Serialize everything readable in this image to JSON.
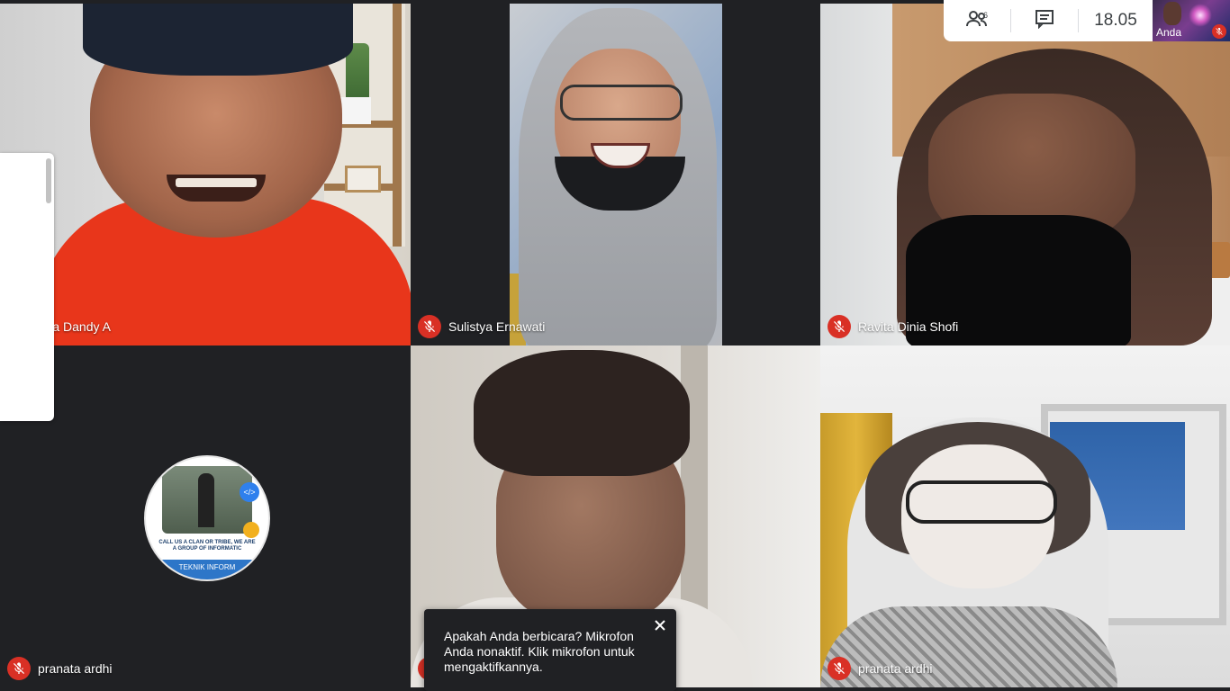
{
  "participants": [
    {
      "name": "Eza Dandy A",
      "mic": "off"
    },
    {
      "name": "Sulistya Ernawati",
      "mic": "off"
    },
    {
      "name": "Ravita Dinia Shofi",
      "mic": "off"
    },
    {
      "name": "pranata ardhi",
      "mic": "off"
    },
    {
      "name": "",
      "mic": "off"
    },
    {
      "name": "pranata ardhi",
      "mic": "off"
    }
  ],
  "avatar": {
    "slogan": "CALL US A CLAN OR TRIBE, WE ARE A GROUP OF INFORMATIC",
    "band": "TEKNIK INFORM"
  },
  "toolbar": {
    "people_count": "6",
    "time": "18.05"
  },
  "self_view": {
    "label": "Anda"
  },
  "toast": {
    "message": "Apakah Anda berbicara? Mikrofon Anda nonaktif. Klik mikrofon untuk mengaktifkannya."
  },
  "colors": {
    "background": "#202124",
    "mic_off": "#d93025",
    "toolbar": "#ffffff"
  },
  "icons": [
    "mic-off-icon",
    "people-icon",
    "chat-icon",
    "close-icon"
  ]
}
